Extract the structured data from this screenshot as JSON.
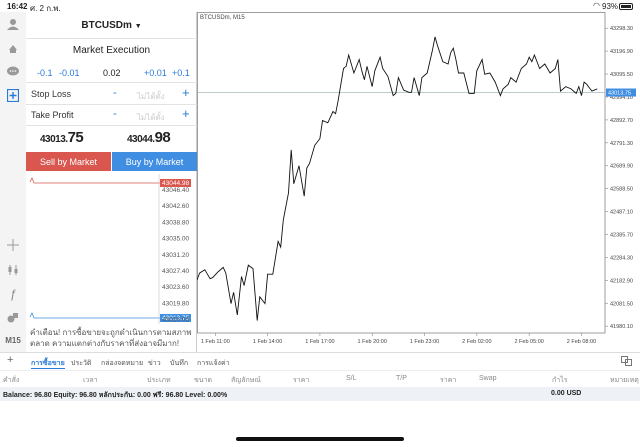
{
  "status": {
    "time": "16:42",
    "date": "ศ. 2 ก.พ.",
    "battery": "93%",
    "battery_level": 0.93
  },
  "trade": {
    "symbol": "BTCUSDm",
    "execution": "Market Execution",
    "volume": {
      "dec2": "-0.1",
      "dec1": "-0.01",
      "value": "0.02",
      "inc1": "+0.01",
      "inc2": "+0.1"
    },
    "stop_loss": {
      "label": "Stop Loss",
      "placeholder": "ไม่ได้ตั้ง"
    },
    "take_profit": {
      "label": "Take Profit",
      "placeholder": "ไม่ได้ตั้ง"
    },
    "sell_price": {
      "main": "43013.",
      "big": "75"
    },
    "buy_price": {
      "main": "43044.",
      "big": "98"
    },
    "sell_label": "Sell by Market",
    "buy_label": "Buy by Market",
    "disclaimer": "คำเตือน! การซื้อขายจะถูกดำเนินการตามสภาพตลาด ความแตกต่างกับราคาที่ส่งอาจมีมาก!",
    "mini_ticks": [
      "43046.40",
      "43042.60",
      "43038.80",
      "43035.00",
      "43031.20",
      "43027.40",
      "43023.60",
      "43019.80",
      "43016.00"
    ],
    "mini_ask": "43044.98",
    "mini_bid": "43013.75"
  },
  "chart_data": {
    "type": "line",
    "title": "BTCUSDm, M15",
    "current_price": "43013.75",
    "y_ticks": [
      "43298.30",
      "43196.90",
      "43095.50",
      "42994.10",
      "42892.70",
      "42791.30",
      "42689.90",
      "42588.50",
      "42487.10",
      "42385.70",
      "42284.30",
      "42182.90",
      "42081.50",
      "41980.10"
    ],
    "x_ticks": [
      "1 Feb 11:00",
      "1 Feb 14:00",
      "1 Feb 17:00",
      "1 Feb 20:00",
      "1 Feb 23:00",
      "2 Feb 02:00",
      "2 Feb 05:00",
      "2 Feb 08:00"
    ],
    "ylim": [
      41950,
      43370
    ],
    "x_span": [
      -0.35,
      7.45
    ],
    "x": [
      -0.35,
      -0.3,
      -0.2,
      -0.1,
      -0.05,
      0.05,
      0.15,
      0.2,
      0.3,
      0.35,
      0.42,
      0.5,
      0.55,
      0.63,
      0.72,
      0.8,
      0.85,
      0.95,
      1.0,
      1.1,
      1.2,
      1.25,
      1.3,
      1.4,
      1.45,
      1.5,
      1.6,
      1.7,
      1.75,
      1.8,
      1.9,
      2.0,
      2.05,
      2.15,
      2.25,
      2.3,
      2.35,
      2.45,
      2.5,
      2.55,
      2.65,
      2.75,
      2.8,
      2.85,
      2.9,
      3.0,
      3.05,
      3.15,
      3.2,
      3.3,
      3.4,
      3.45,
      3.5,
      3.6,
      3.7,
      3.75,
      3.8,
      3.9,
      3.95,
      4.05,
      4.15,
      4.2,
      4.25,
      4.35,
      4.45,
      4.5,
      4.55,
      4.6,
      4.65,
      4.75,
      4.85,
      4.95,
      5.0,
      5.1,
      5.15,
      5.25,
      5.35,
      5.45,
      5.5,
      5.6,
      5.65,
      5.75,
      5.85,
      5.95,
      6.0,
      6.05,
      6.1,
      6.2,
      6.3,
      6.4,
      6.5,
      6.55,
      6.6,
      6.7,
      6.8,
      6.9,
      6.95,
      7.0,
      7.05,
      7.1,
      7.2,
      7.3
    ],
    "y": [
      42185,
      42215,
      42230,
      42190,
      42195,
      42220,
      42240,
      42215,
      42080,
      42130,
      42030,
      42200,
      42160,
      42250,
      42235,
      42005,
      42110,
      42080,
      42210,
      42210,
      42355,
      42330,
      42450,
      42570,
      42760,
      42610,
      42690,
      42555,
      42680,
      42700,
      42780,
      42810,
      42890,
      42880,
      42930,
      42920,
      42980,
      43120,
      43130,
      43180,
      43100,
      43160,
      43110,
      43070,
      43130,
      43040,
      43110,
      43170,
      43120,
      43085,
      43000,
      43010,
      43080,
      43025,
      43015,
      43015,
      43080,
      43000,
      43080,
      43100,
      43200,
      43260,
      43220,
      43150,
      43140,
      43190,
      43210,
      43160,
      43100,
      43100,
      43010,
      43010,
      43110,
      43160,
      43095,
      43100,
      43060,
      43000,
      43030,
      43050,
      43080,
      43060,
      43120,
      43140,
      43170,
      43150,
      43180,
      43120,
      43140,
      43100,
      43120,
      43160,
      43020,
      43040,
      43030,
      43010,
      43040,
      43000,
      43060,
      43050,
      43020,
      43030
    ],
    "grid": false
  },
  "bottom": {
    "tabs": [
      "การซื้อขาย",
      "ประวัติ",
      "กล่องจดหมาย",
      "ข่าว",
      "บันทึก",
      "การแจ้งค่า"
    ],
    "columns": [
      "คำสั่ง",
      "เวลา",
      "ประเภท",
      "ขนาด",
      "สัญลักษณ์",
      "ราคา",
      "S/L",
      "T/P",
      "ราคา",
      "Swap",
      "กำไร",
      "หมายเหตุ"
    ],
    "balance_text": "Balance: 96.80 Equity: 96.80 หลักประกัน: 0.00 ฟรี: 96.80 Level: 0.00%",
    "profit_total": "0.00  USD"
  },
  "colors": {
    "accent": "#2979d8",
    "sell": "#d9574f",
    "buy": "#3f8ee2"
  }
}
